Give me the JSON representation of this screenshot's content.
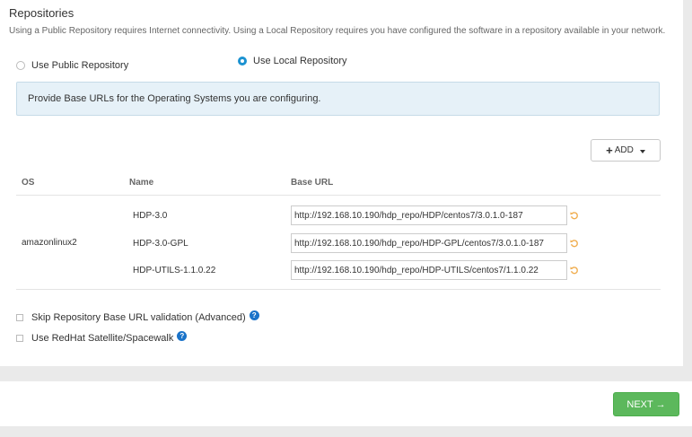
{
  "section": {
    "title": "Repositories",
    "subtitle": "Using a Public Repository requires Internet connectivity. Using a Local Repository requires you have configured the software in a repository available in your network."
  },
  "repo_options": {
    "public_label": "Use Public Repository",
    "local_label": "Use Local Repository",
    "selected": "local"
  },
  "info": {
    "text": "Provide Base URLs for the Operating Systems you are configuring."
  },
  "add_button": {
    "label": "ADD"
  },
  "table": {
    "headers": {
      "os": "OS",
      "name": "Name",
      "base_url": "Base URL"
    },
    "os": "amazonlinux2",
    "rows": [
      {
        "name": "HDP-3.0",
        "url": "http://192.168.10.190/hdp_repo/HDP/centos7/3.0.1.0-187"
      },
      {
        "name": "HDP-3.0-GPL",
        "url": "http://192.168.10.190/hdp_repo/HDP-GPL/centos7/3.0.1.0-187"
      },
      {
        "name": "HDP-UTILS-1.1.0.22",
        "url": "http://192.168.10.190/hdp_repo/HDP-UTILS/centos7/1.1.0.22"
      }
    ]
  },
  "options": {
    "skip_validation": "Skip Repository Base URL validation (Advanced)",
    "satellite": "Use RedHat Satellite/Spacewalk"
  },
  "footer": {
    "next_label": "NEXT →"
  },
  "colors": {
    "accent": "#1b92d1",
    "next_button": "#5cb85c",
    "undo_icon": "#f0ad4e",
    "help_icon": "#1a73c9"
  }
}
